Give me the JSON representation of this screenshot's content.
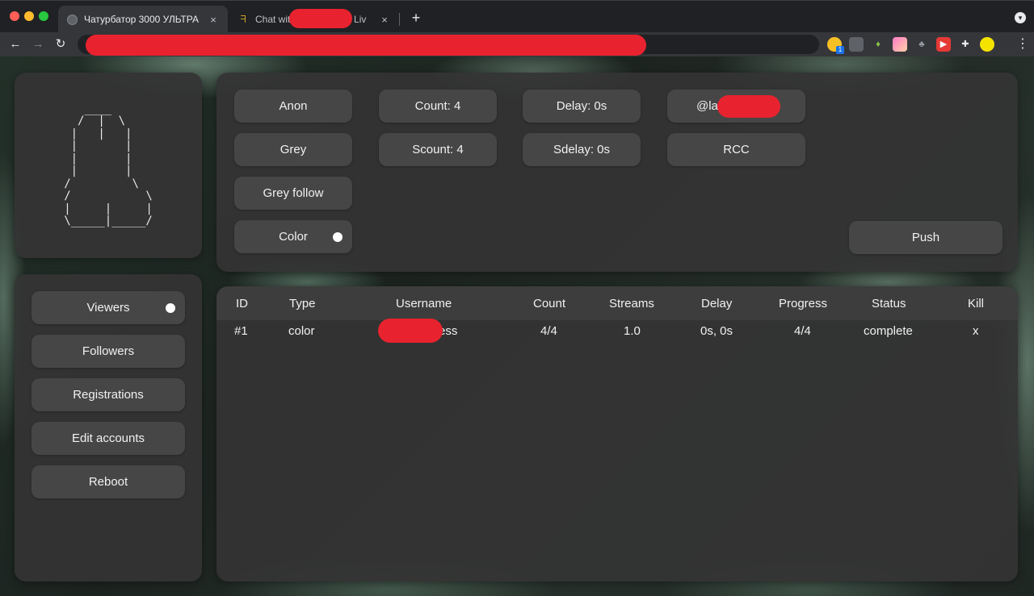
{
  "browser": {
    "tabs": [
      {
        "title": "Чатурбатор 3000 УЛЬТРА",
        "active": true,
        "icon": "globe-icon"
      },
      {
        "title": "Chat with",
        "title_tail": "n a Liv",
        "active": false,
        "icon": "bird-icon"
      }
    ],
    "close_glyph": "×",
    "new_tab_glyph": "+",
    "back_glyph": "←",
    "forward_glyph": "→",
    "reload_glyph": "↻",
    "menu_glyph": "⋮",
    "extensions": [
      {
        "name": "smiley-extension-icon",
        "color": "#f6c026",
        "badge": "1"
      },
      {
        "name": "tiles-extension-icon",
        "color": "#5f6368"
      },
      {
        "name": "leaf-extension-icon",
        "color": "#8bc34a"
      },
      {
        "name": "gradient-extension-icon",
        "color": "#ff7ac8"
      },
      {
        "name": "spy-extension-icon",
        "color": "#9aa0a6"
      },
      {
        "name": "record-extension-icon",
        "color": "#e53935"
      },
      {
        "name": "puzzle-extension-icon",
        "color": "#e8eaed"
      },
      {
        "name": "profile-avatar-icon",
        "color": "#f4e300"
      }
    ]
  },
  "logo": {
    "ascii": "   ____\n  /  |  \\\n |   |   |\n |       |\n |       |\n |       |\n/         \\\n/           \\\n|     |     |\n\\_____|_____/"
  },
  "controls": {
    "anon": "Anon",
    "grey": "Grey",
    "grey_follow": "Grey follow",
    "color": "Color",
    "count": "Count: 4",
    "scount": "Scount: 4",
    "delay": "Delay: 0s",
    "sdelay": "Sdelay: 0s",
    "target": "@la",
    "rcc": "RCC",
    "push": "Push"
  },
  "nav": {
    "viewers": "Viewers",
    "followers": "Followers",
    "registrations": "Registrations",
    "edit_accounts": "Edit accounts",
    "reboot": "Reboot"
  },
  "table": {
    "headers": {
      "id": "ID",
      "type": "Type",
      "username": "Username",
      "count": "Count",
      "streams": "Streams",
      "delay": "Delay",
      "progress": "Progress",
      "status": "Status",
      "kill": "Kill"
    },
    "rows": [
      {
        "id": "#1",
        "type": "color",
        "username": "ess",
        "count": "4/4",
        "streams": "1.0",
        "delay": "0s, 0s",
        "progress": "4/4",
        "status": "complete",
        "kill": "x"
      }
    ]
  },
  "colors": {
    "panel": "#343434",
    "button": "#464646",
    "redaction": "#e8232f"
  }
}
